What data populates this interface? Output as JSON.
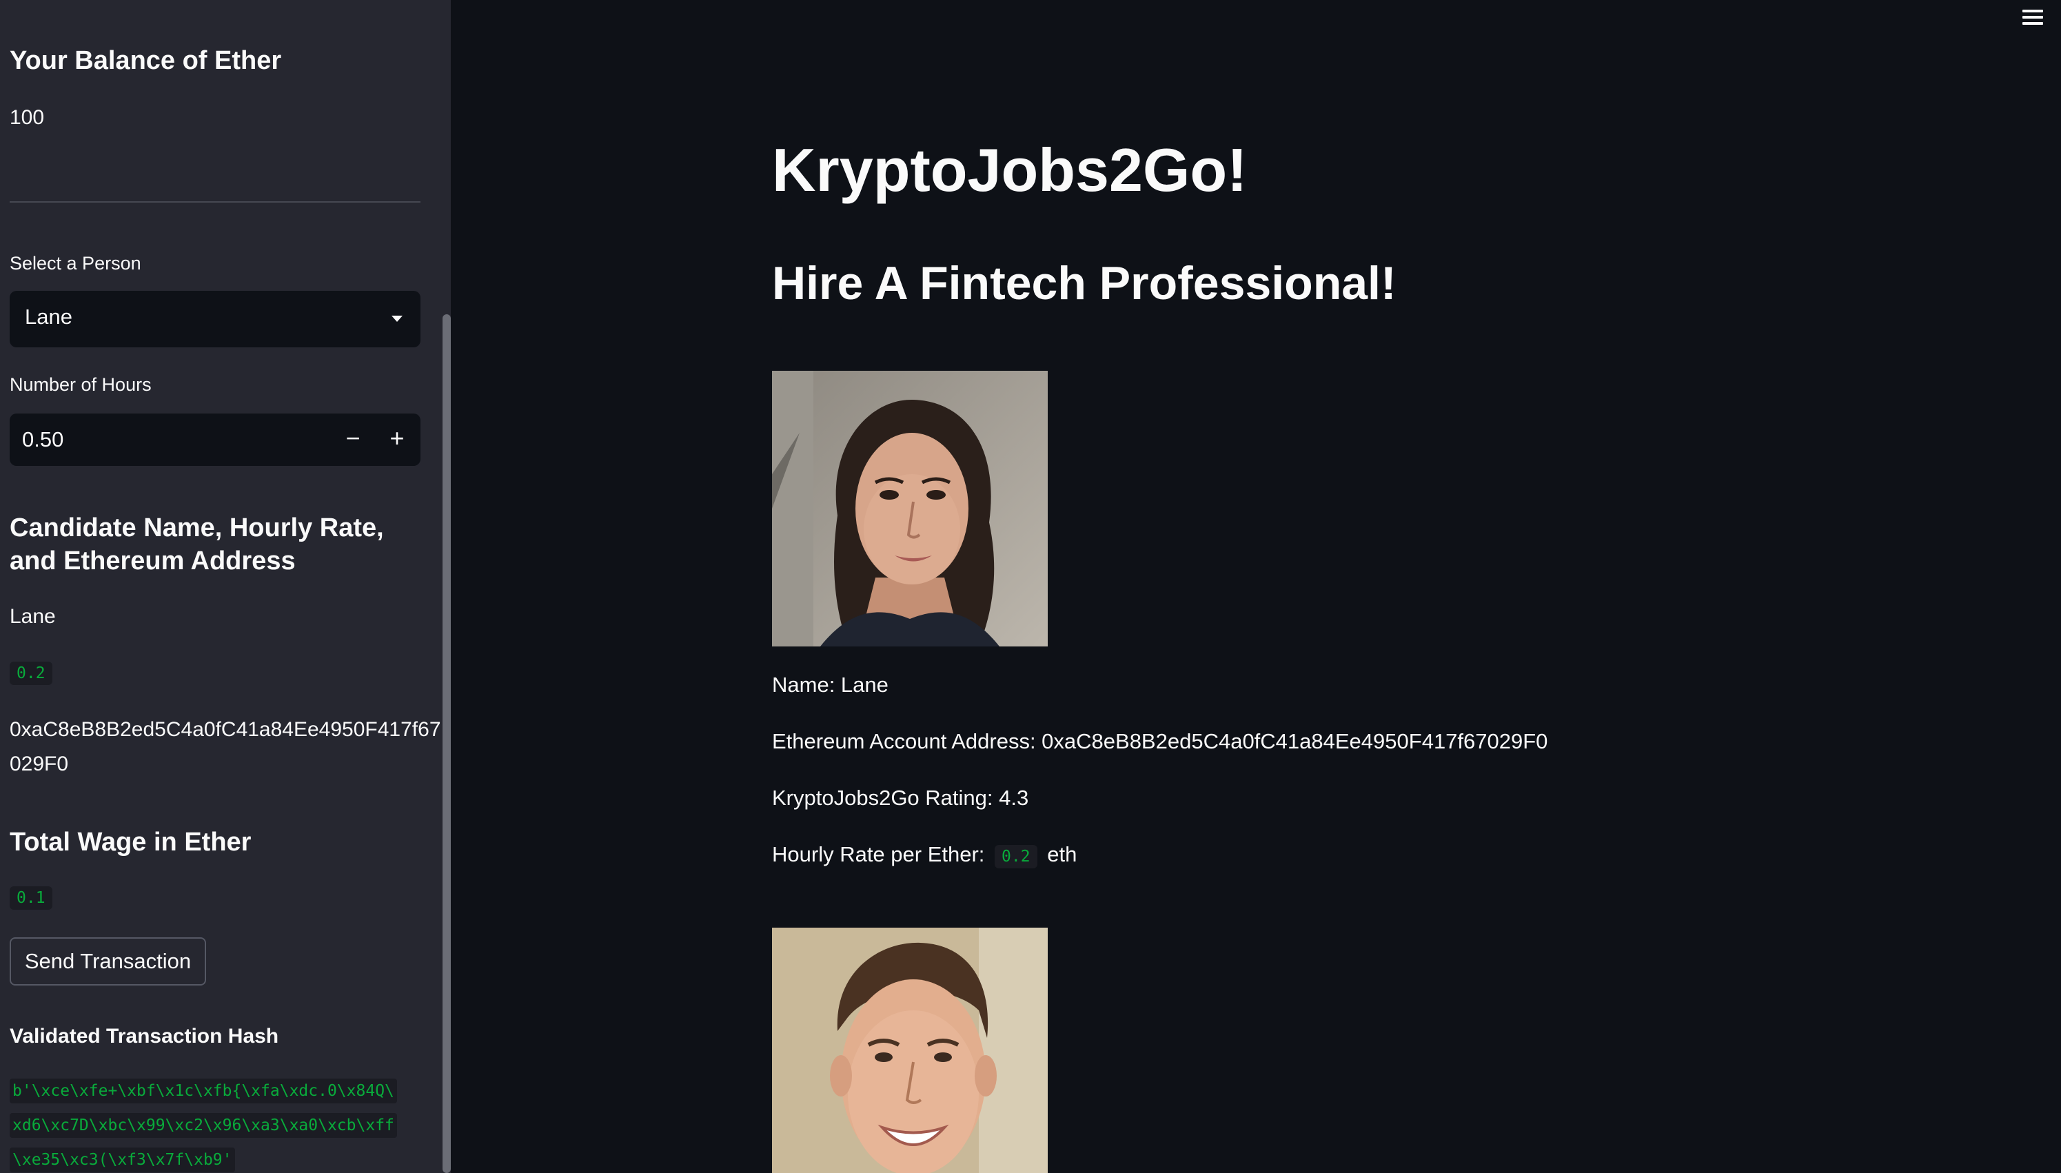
{
  "sidebar": {
    "balance_heading": "Your Balance of Ether",
    "balance_value": "100",
    "select_label": "Select a Person",
    "select_value": "Lane",
    "hours_label": "Number of Hours",
    "hours_value": "0.50",
    "stepper_minus": "−",
    "stepper_plus": "+",
    "candidate_heading": "Candidate Name, Hourly Rate, and Ethereum Address",
    "candidate_name": "Lane",
    "candidate_rate": "0.2",
    "candidate_address_line1": "0xaC8eB8B2ed5C4a0fC41a84Ee4950F417f67",
    "candidate_address_line2": "029F0",
    "wage_heading": "Total Wage in Ether",
    "wage_value": "0.1",
    "send_button": "Send Transaction",
    "hash_heading": "Validated Transaction Hash",
    "hash_lines": [
      "b'\\xce\\xfe+\\xbf\\x1c\\xfb{\\xfa\\xdc.0\\x84Q\\",
      "xd6\\xc7D\\xbc\\x99\\xc2\\x96\\xa3\\xa0\\xcb\\xff",
      "\\xe35\\xc3(\\xf3\\x7f\\xb9'"
    ]
  },
  "main": {
    "title": "KryptoJobs2Go!",
    "subtitle": "Hire A Fintech Professional!",
    "candidates": [
      {
        "name_line": "Name: Lane",
        "address_line": "Ethereum Account Address: 0xaC8eB8B2ed5C4a0fC41a84Ee4950F417f67029F0",
        "rating_line": "KryptoJobs2Go Rating: 4.3",
        "rate_prefix": "Hourly Rate per Ether:",
        "rate_value": "0.2",
        "rate_suffix": "eth"
      }
    ]
  },
  "colors": {
    "app_background": "#0e1117",
    "sidebar_background": "#262730",
    "code_text": "#09ab3b"
  }
}
